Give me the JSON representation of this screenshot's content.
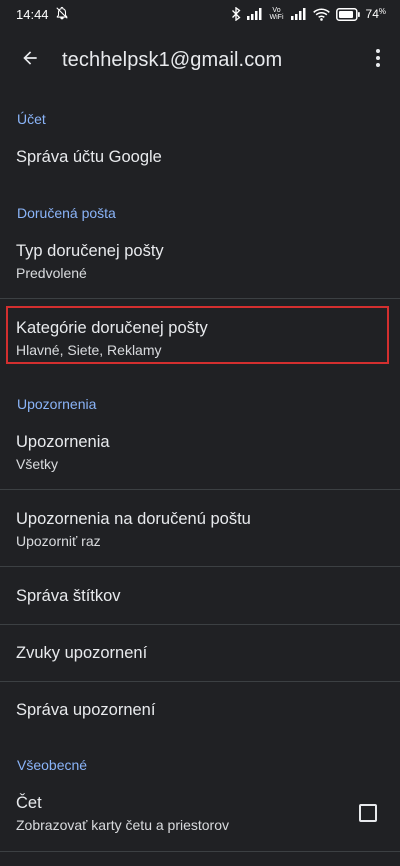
{
  "status_bar": {
    "time": "14:44",
    "battery_percent": "74",
    "battery_suffix": "%",
    "network_label": "Vo WiFi"
  },
  "app_bar": {
    "title": "techhelpsk1@gmail.com"
  },
  "sections": {
    "account": {
      "header": "Účet",
      "manage_account": "Správa účtu Google"
    },
    "inbox": {
      "header": "Doručená pošta",
      "type_title": "Typ doručenej pošty",
      "type_value": "Predvolené",
      "categories_title": "Kategórie doručenej pošty",
      "categories_value": "Hlavné, Siete, Reklamy"
    },
    "notifications": {
      "header": "Upozornenia",
      "notif_title": "Upozornenia",
      "notif_value": "Všetky",
      "inbox_notif_title": "Upozornenia na doručenú poštu",
      "inbox_notif_value": "Upozorniť raz",
      "manage_labels": "Správa štítkov",
      "notif_sounds": "Zvuky upozornení",
      "manage_notifications": "Správa upozornení"
    },
    "general": {
      "header": "Všeobecné",
      "chat_title": "Čet",
      "chat_value": "Zobrazovať karty četu a priestorov",
      "chat_checked": false
    }
  },
  "colors": {
    "background": "#202124",
    "accent": "#8ab4f8",
    "highlight_border": "#d32f2f"
  }
}
